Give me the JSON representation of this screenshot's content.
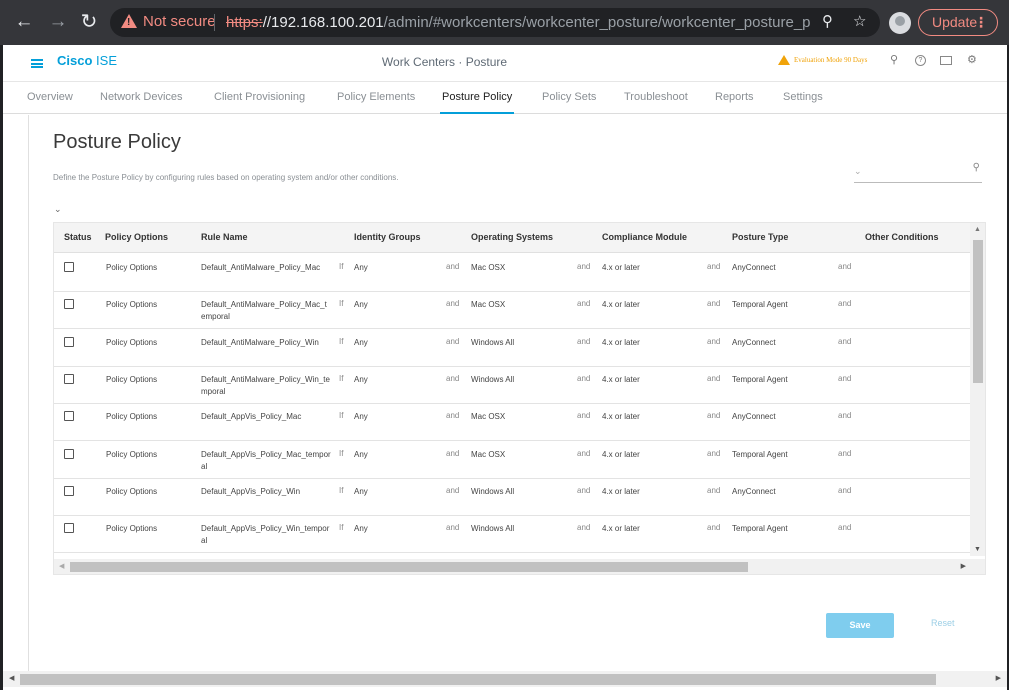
{
  "browser": {
    "not_secure": "Not secure",
    "url_scheme": "https:",
    "url_host": "//192.168.100.201",
    "url_path": "/admin/#workcenters/workcenter_posture/workcenter_posture_posture...",
    "update_label": "Update"
  },
  "header": {
    "logo_bold": "Cisco",
    "logo_light": "ISE",
    "title": "Work Centers · Posture",
    "evaluation": "Evaluation Mode 90 Days"
  },
  "tabs": [
    "Overview",
    "Network Devices",
    "Client Provisioning",
    "Policy Elements",
    "Posture Policy",
    "Policy Sets",
    "Troubleshoot",
    "Reports",
    "Settings"
  ],
  "active_tab": "Posture Policy",
  "main": {
    "title": "Posture Policy",
    "description": "Define the Posture Policy by configuring rules based on operating system and/or other conditions."
  },
  "table": {
    "headers": {
      "status": "Status",
      "policy_options": "Policy Options",
      "rule_name": "Rule Name",
      "identity_groups": "Identity Groups",
      "operating_systems": "Operating Systems",
      "compliance_module": "Compliance Module",
      "posture_type": "Posture Type",
      "other_conditions": "Other Conditions"
    },
    "kw_if": "If",
    "kw_and": "and",
    "rows": [
      {
        "options": "Policy Options",
        "rule": "Default_AntiMalware_Policy_Mac",
        "identity": "Any",
        "os": "Mac OSX",
        "module": "4.x or later",
        "posture": "AnyConnect"
      },
      {
        "options": "Policy Options",
        "rule": "Default_AntiMalware_Policy_Mac_temporal",
        "identity": "Any",
        "os": "Mac OSX",
        "module": "4.x or later",
        "posture": "Temporal Agent"
      },
      {
        "options": "Policy Options",
        "rule": "Default_AntiMalware_Policy_Win",
        "identity": "Any",
        "os": "Windows All",
        "module": "4.x or later",
        "posture": "AnyConnect"
      },
      {
        "options": "Policy Options",
        "rule": "Default_AntiMalware_Policy_Win_temporal",
        "identity": "Any",
        "os": "Windows All",
        "module": "4.x or later",
        "posture": "Temporal Agent"
      },
      {
        "options": "Policy Options",
        "rule": "Default_AppVis_Policy_Mac",
        "identity": "Any",
        "os": "Mac OSX",
        "module": "4.x or later",
        "posture": "AnyConnect"
      },
      {
        "options": "Policy Options",
        "rule": "Default_AppVis_Policy_Mac_temporal",
        "identity": "Any",
        "os": "Mac OSX",
        "module": "4.x or later",
        "posture": "Temporal Agent"
      },
      {
        "options": "Policy Options",
        "rule": "Default_AppVis_Policy_Win",
        "identity": "Any",
        "os": "Windows All",
        "module": "4.x or later",
        "posture": "AnyConnect"
      },
      {
        "options": "Policy Options",
        "rule": "Default_AppVis_Policy_Win_temporal",
        "identity": "Any",
        "os": "Windows All",
        "module": "4.x or later",
        "posture": "Temporal Agent"
      }
    ]
  },
  "actions": {
    "save": "Save",
    "reset": "Reset"
  },
  "colors": {
    "accent": "#049fd9",
    "warning": "#f0a30a",
    "not_secure": "#f28b82"
  }
}
